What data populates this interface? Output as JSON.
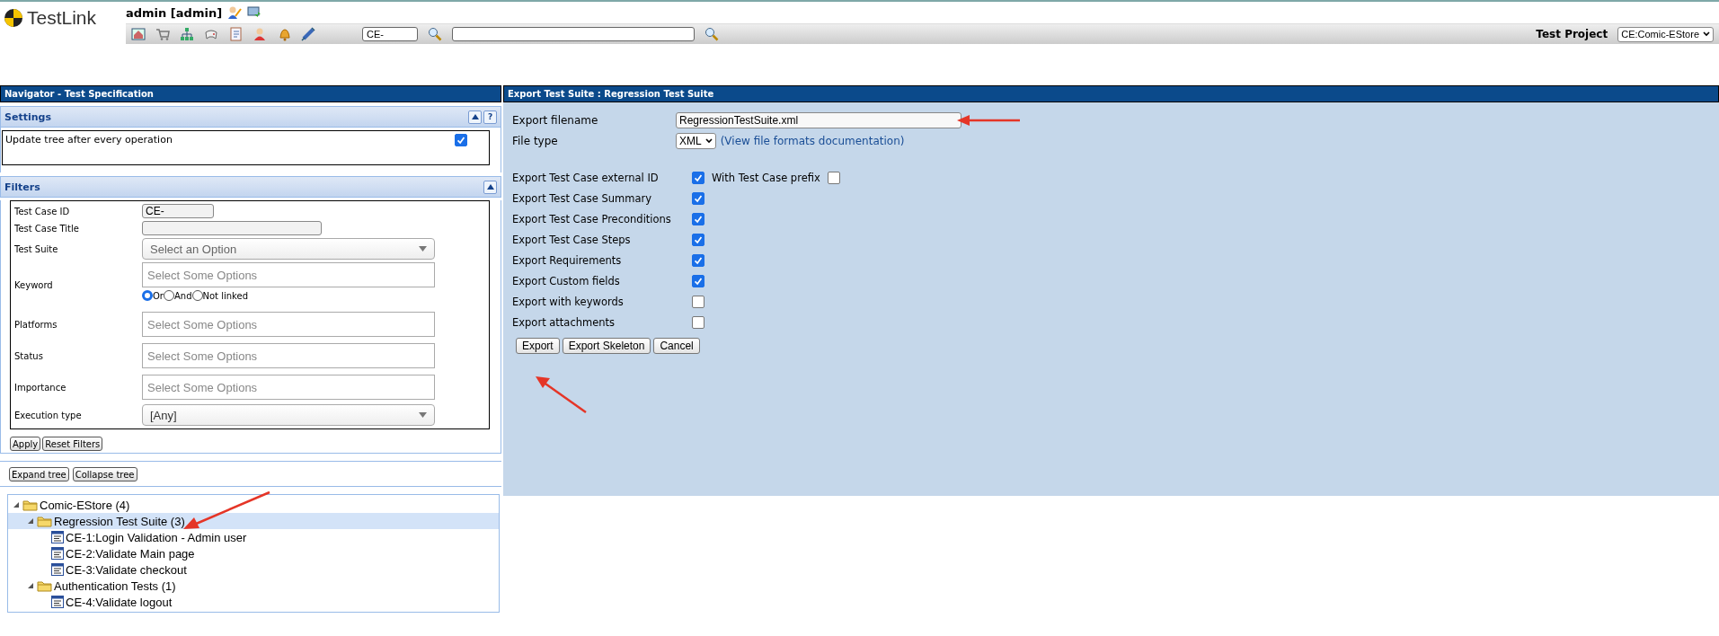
{
  "header": {
    "logo": "TestLink",
    "user": "admin [admin]",
    "search": {
      "value": "CE-"
    },
    "project_label": "Test Project",
    "project": "CE:Comic-EStore"
  },
  "navigator": {
    "title": "Navigator - Test Specification",
    "settings": {
      "title": "Settings",
      "expanded": true,
      "help": "?",
      "option": {
        "label": "Update tree after every operation",
        "checked": true
      }
    },
    "filters": {
      "title": "Filters",
      "expanded": true,
      "fields": [
        {
          "label": "Test Case ID",
          "kind": "text",
          "value": "CE-"
        },
        {
          "label": "Test Case Title",
          "kind": "text"
        },
        {
          "label": "Test Suite",
          "kind": "select",
          "placeholder": "Select an Option"
        },
        {
          "label": "Keyword",
          "kind": "multiselect",
          "placeholder": "Select Some Options",
          "options": [
            {
              "label": "Or",
              "selected": true
            },
            {
              "label": "And",
              "selected": false
            },
            {
              "label": "Not linked",
              "selected": false
            }
          ]
        },
        {
          "label": "Platforms",
          "kind": "multiselect",
          "placeholder": "Select Some Options"
        },
        {
          "label": "Status",
          "kind": "multiselect",
          "placeholder": "Select Some Options"
        },
        {
          "label": "Importance",
          "kind": "multiselect",
          "placeholder": "Select Some Options"
        },
        {
          "label": "Execution type",
          "kind": "select",
          "value": "[Any]"
        }
      ],
      "buttons": [
        "Apply",
        "Reset Filters"
      ]
    },
    "tree_buttons": [
      "Expand tree",
      "Collapse tree"
    ],
    "tree": [
      {
        "label": "Comic-EStore (4)",
        "kind": "folder",
        "expanded": true,
        "selected": false,
        "children": [
          {
            "label": "Regression Test Suite (3)",
            "kind": "folder",
            "expanded": true,
            "selected": true,
            "children": [
              {
                "label": "CE-1:Login Validation - Admin user",
                "kind": "testcase",
                "selected": false
              },
              {
                "label": "CE-2:Validate Main page",
                "kind": "testcase",
                "selected": false
              },
              {
                "label": "CE-3:Validate checkout",
                "kind": "testcase",
                "selected": false
              }
            ]
          },
          {
            "label": "Authentication Tests (1)",
            "kind": "folder",
            "expanded": true,
            "selected": false,
            "children": [
              {
                "label": "CE-4:Validate logout",
                "kind": "testcase",
                "selected": false
              }
            ]
          }
        ]
      }
    ]
  },
  "export": {
    "title": "Export Test Suite : Regression Test Suite",
    "filename_label": "Export filename",
    "filename": "RegressionTestSuite.xml",
    "filetype_label": "File type",
    "filetype": "XML",
    "doc_link": "(View file formats documentation)",
    "options": [
      {
        "label": "Export Test Case external ID",
        "checked": true,
        "extra": {
          "label": "With Test Case prefix",
          "checked": false
        }
      },
      {
        "label": "Export Test Case Summary",
        "checked": true
      },
      {
        "label": "Export Test Case Preconditions",
        "checked": true
      },
      {
        "label": "Export Test Case Steps",
        "checked": true
      },
      {
        "label": "Export Requirements",
        "checked": true
      },
      {
        "label": "Export Custom fields",
        "checked": true
      },
      {
        "label": "Export with keywords",
        "checked": false
      },
      {
        "label": "Export attachments",
        "checked": false
      }
    ],
    "buttons": [
      "Export",
      "Export Skeleton",
      "Cancel"
    ]
  }
}
